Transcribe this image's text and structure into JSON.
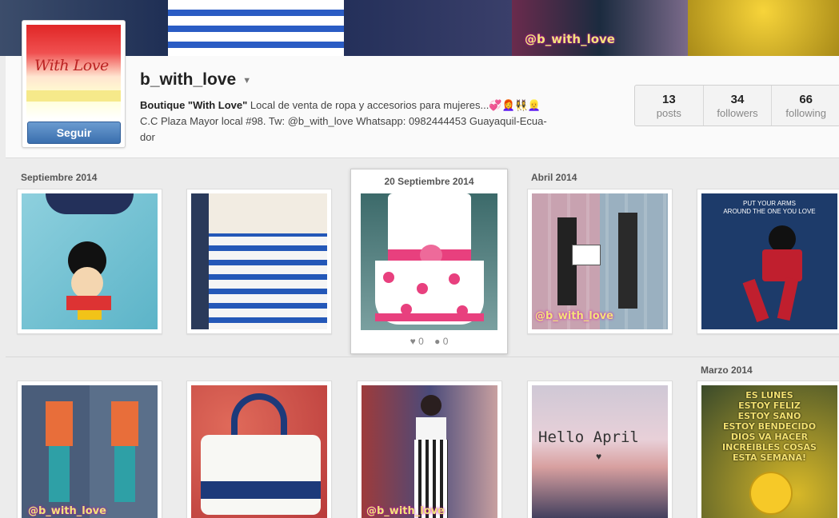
{
  "profile": {
    "username": "b_with_love",
    "avatar_text": "With Love",
    "follow_label": "Seguir",
    "bio_bold": "Boutique \"With Love\"",
    "bio_line1": " Local de venta de ropa y accesorios para mujeres...💞👩‍🦰👯‍♀️👱‍♀️",
    "bio_line2": "C.C Plaza Mayor local #98. Tw: @b_with_love Whatsapp: 0982444453 Guayaquil-Ecua-",
    "bio_line3": "dor"
  },
  "stats": [
    {
      "num": "13",
      "label": "posts"
    },
    {
      "num": "34",
      "label": "followers"
    },
    {
      "num": "66",
      "label": "following"
    }
  ],
  "months": {
    "sep": "Septiembre 2014",
    "sep20": "20 Septiembre 2014",
    "apr": "Abril 2014",
    "mar": "Marzo 2014"
  },
  "active_post": {
    "likes": "0",
    "comments": "0"
  },
  "posts": [
    {
      "alt": "Mickey Mouse t-shirt"
    },
    {
      "alt": "Blue striped dress"
    },
    {
      "alt": "Pink floral dress"
    },
    {
      "alt": "Boutique store collage"
    },
    {
      "alt": "Put your arms around the one you love",
      "text": "PUT YOUR ARMS\nAROUND THE ONE YOU LOVE"
    },
    {
      "alt": "Mannequins collage"
    },
    {
      "alt": "White handbag"
    },
    {
      "alt": "Striped strapless dress"
    },
    {
      "alt": "Hello April",
      "text": "Hello April"
    },
    {
      "alt": "Es lunes",
      "text": "ES LUNES\nESTOY FELIZ\nESTOY SANO\nESTOY BENDECIDO\nDIOS VA HACER\nINCREIBLES COSAS\nESTA SEMANA!"
    }
  ],
  "watermark": "@b_with_love",
  "colors": {
    "follow_button": "#3a6fae",
    "accent_red": "#e02626"
  }
}
